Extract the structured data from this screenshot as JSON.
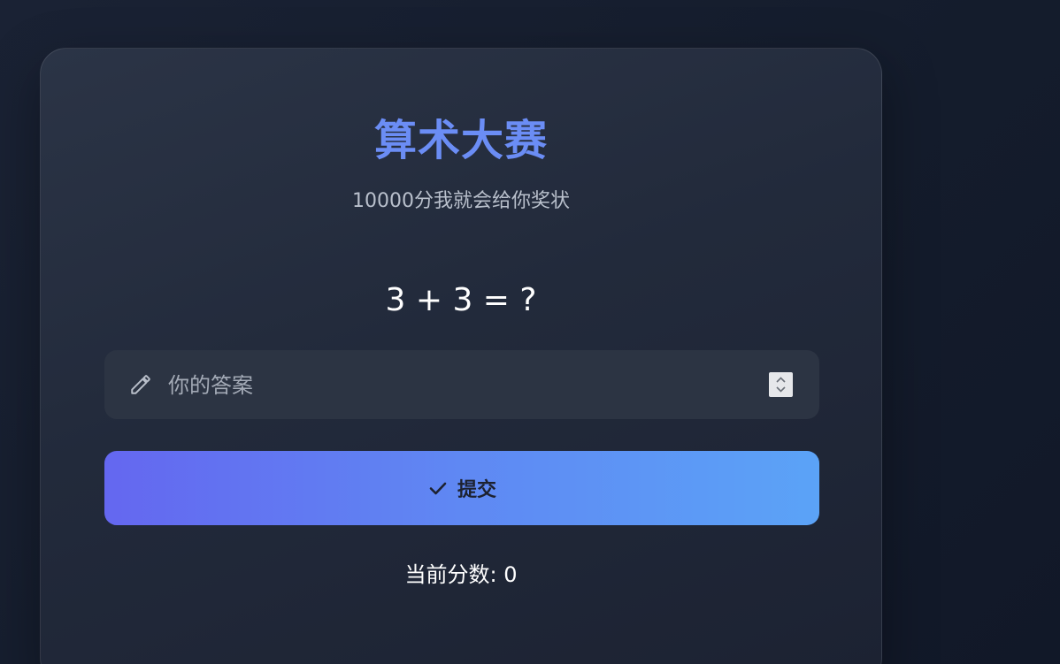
{
  "game": {
    "title": "算术大赛",
    "subtitle": "10000分我就会给你奖状",
    "question": "3 + 3 = ?",
    "answer": {
      "value": "",
      "placeholder": "你的答案",
      "icon": "pencil-icon"
    },
    "submit": {
      "label": "提交",
      "icon": "check-icon"
    },
    "score_text": "当前分数: 0"
  },
  "colors": {
    "title": "#6b8df5",
    "button_start": "#6467f0",
    "button_end": "#5ba3f7",
    "background": "#161e2e"
  }
}
